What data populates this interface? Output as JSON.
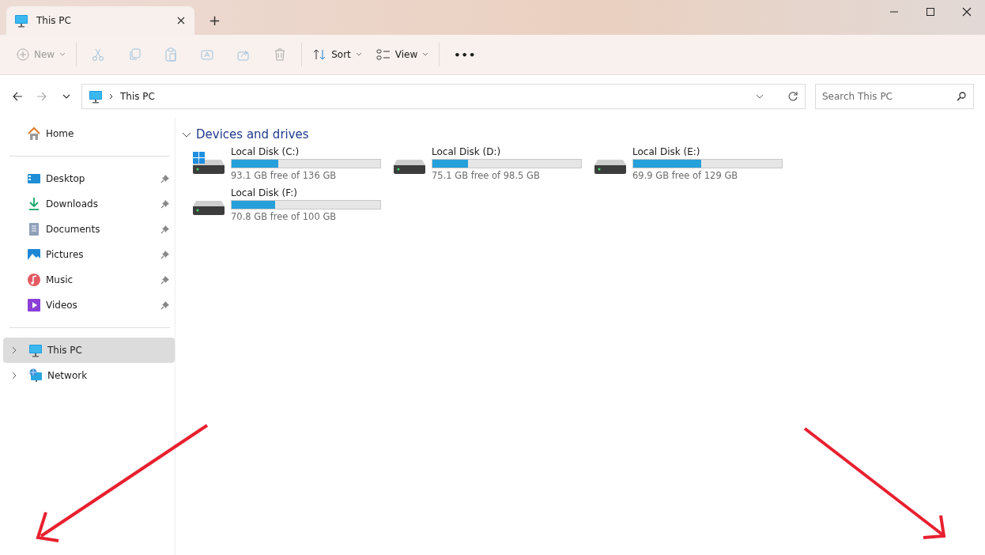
{
  "window": {
    "tabs": [
      {
        "title": "This PC",
        "selected": true
      }
    ],
    "new_tab": "+"
  },
  "toolbar": {
    "new": {
      "label": "New",
      "disabled": true
    },
    "icon_buttons": [
      {
        "disabled": true
      },
      {
        "disabled": true
      },
      {
        "disabled": true
      },
      {
        "disabled": true
      },
      {
        "disabled": true
      },
      {
        "disabled": true
      }
    ],
    "sort": {
      "label": "Sort",
      "disabled": false
    },
    "view": {
      "label": "View",
      "disabled": false
    },
    "more": "•••"
  },
  "address_bar": {
    "path": "This PC",
    "back_disabled": false,
    "forward_disabled": true
  },
  "search": {
    "placeholder": "Search This PC"
  },
  "sidebar": {
    "home": {
      "label": "Home"
    },
    "quick_access": [
      {
        "label": "Desktop",
        "pinned": true
      },
      {
        "label": "Downloads",
        "pinned": true
      },
      {
        "label": "Documents",
        "pinned": true
      },
      {
        "label": "Pictures",
        "pinned": true
      },
      {
        "label": "Music",
        "pinned": true
      },
      {
        "label": "Videos",
        "pinned": true
      }
    ],
    "tree": [
      {
        "label": "This PC",
        "selected": true,
        "expanded": false
      },
      {
        "label": "Network",
        "selected": false,
        "expanded": false
      }
    ]
  },
  "section": {
    "title": "Devices and drives",
    "expanded": true,
    "drives": [
      {
        "name": "Local Disk (C:)",
        "system": true,
        "level": 0.315,
        "reading": "93.1 GB free of 136 GB"
      },
      {
        "name": "Local Disk (D:)",
        "system": false,
        "level": 0.24,
        "reading": "75.1 GB free of 98.5 GB"
      },
      {
        "name": "Local Disk (E:)",
        "system": false,
        "level": 0.46,
        "reading": "69.9 GB free of 129 GB"
      },
      {
        "name": "Local Disk (F:)",
        "system": false,
        "level": 0.29,
        "reading": "70.8 GB free of 100 GB"
      }
    ]
  }
}
